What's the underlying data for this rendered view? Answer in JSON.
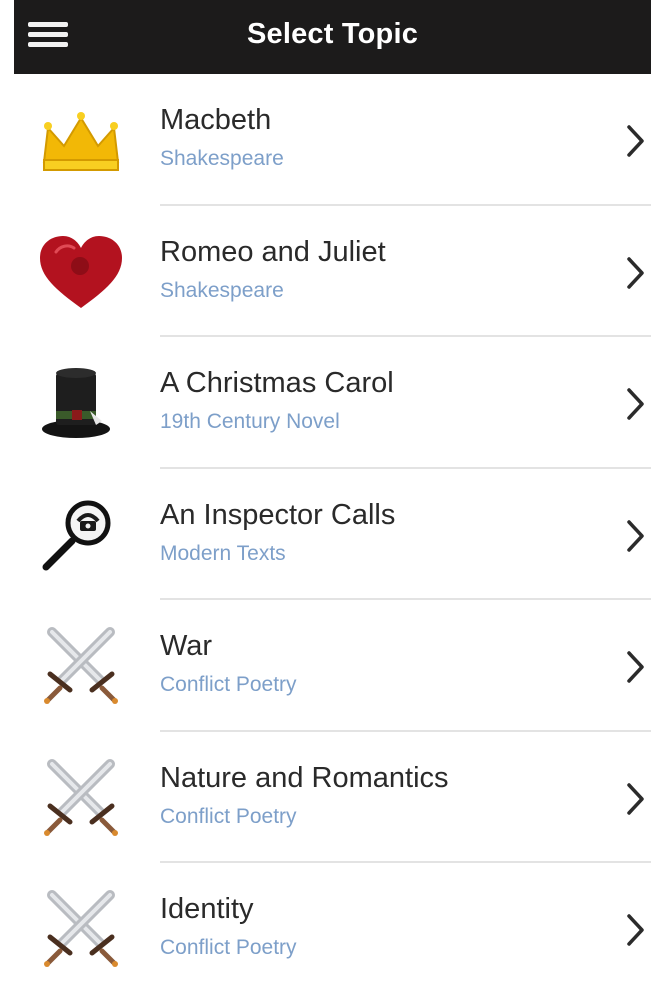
{
  "header": {
    "title": "Select Topic",
    "menu_icon": "hamburger-menu-icon"
  },
  "topics": [
    {
      "title": "Macbeth",
      "subtitle": "Shakespeare",
      "icon": "crown-icon"
    },
    {
      "title": "Romeo and Juliet",
      "subtitle": "Shakespeare",
      "icon": "heart-icon"
    },
    {
      "title": "A Christmas Carol",
      "subtitle": "19th Century Novel",
      "icon": "top-hat-icon"
    },
    {
      "title": "An Inspector Calls",
      "subtitle": "Modern Texts",
      "icon": "magnifying-glass-icon"
    },
    {
      "title": "War",
      "subtitle": "Conflict Poetry",
      "icon": "crossed-swords-icon"
    },
    {
      "title": "Nature and Romantics",
      "subtitle": "Conflict Poetry",
      "icon": "crossed-swords-icon"
    },
    {
      "title": "Identity",
      "subtitle": "Conflict Poetry",
      "icon": "crossed-swords-icon"
    }
  ],
  "colors": {
    "header_bg": "#1c1b1b",
    "title_text": "#2a2a2a",
    "subtitle_text": "#7d9fc9",
    "divider": "#e3e3e3"
  }
}
